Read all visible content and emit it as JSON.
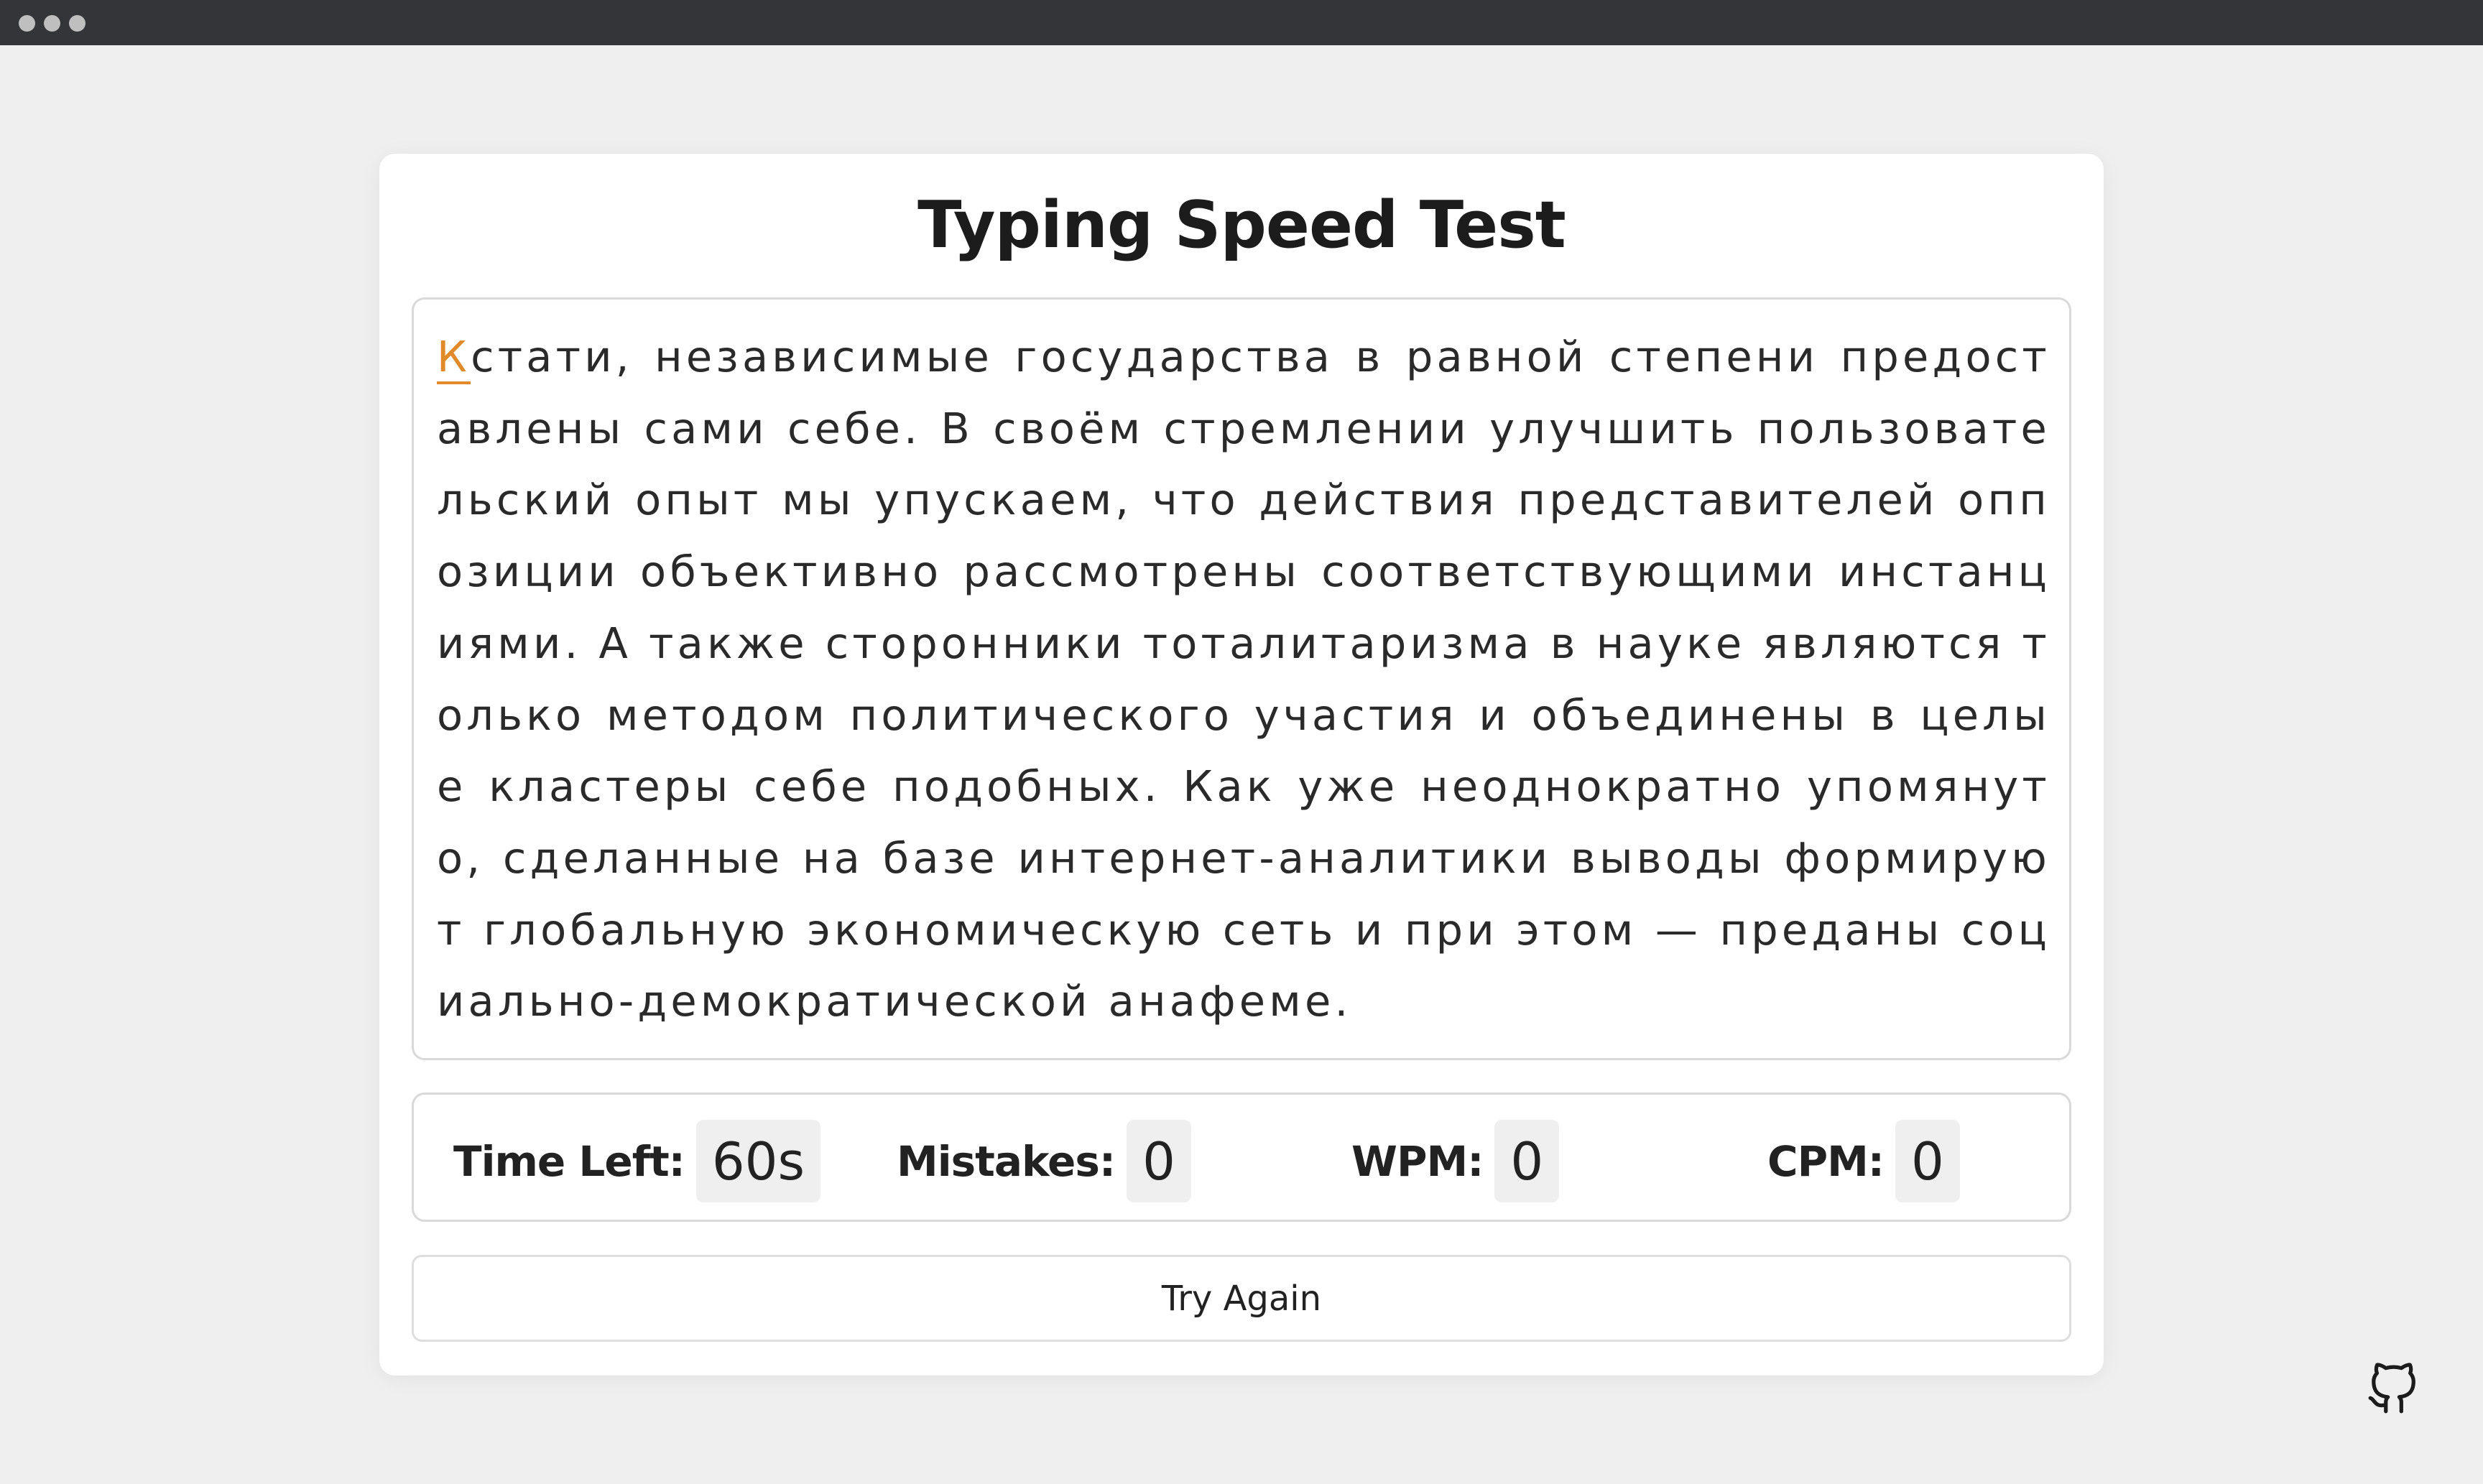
{
  "window": {
    "controls": [
      "dot",
      "dot",
      "dot"
    ]
  },
  "app": {
    "title": "Typing Speed Test"
  },
  "typing": {
    "current_char": "К",
    "remaining_text": "стати, независимые государства в равной степени предоставлены сами себе. В своём стремлении улучшить пользовательский опыт мы упускаем, что действия представителей оппозиции объективно рассмотрены соответствующими инстанциями. А также сторонники тоталитаризма в науке являются только методом политического участия и объединены в целые кластеры себе подобных. Как уже неоднократно упомянуто, сделанные на базе интернет-аналитики выводы формируют глобальную экономическую сеть и при этом — преданы социально-демократической анафеме.",
    "accent_color": "#e08a2a"
  },
  "stats": {
    "time_left": {
      "label": "Time Left:",
      "value": "60s"
    },
    "mistakes": {
      "label": "Mistakes:",
      "value": "0"
    },
    "wpm": {
      "label": "WPM:",
      "value": "0"
    },
    "cpm": {
      "label": "CPM:",
      "value": "0"
    }
  },
  "actions": {
    "try_again_label": "Try Again"
  },
  "footer": {
    "icon": "github-icon"
  }
}
